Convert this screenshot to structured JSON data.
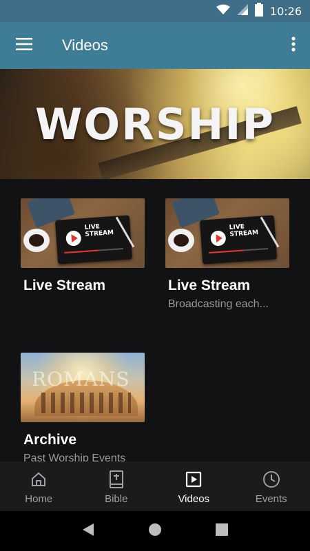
{
  "status_bar": {
    "time": "10:26"
  },
  "app_bar": {
    "title": "Videos"
  },
  "banner": {
    "title": "WORSHIP"
  },
  "cards": [
    {
      "title": "Live Stream",
      "subtitle": "",
      "thumb_text": "LIVE\nSTREAM"
    },
    {
      "title": "Live Stream",
      "subtitle": "Broadcasting each...",
      "thumb_text": "LIVE\nSTREAM"
    },
    {
      "title": "Archive",
      "subtitle": "Past Worship Events",
      "thumb_text": "ROMANS"
    }
  ],
  "bottom_nav": [
    {
      "label": "Home",
      "icon": "home-icon",
      "active": false
    },
    {
      "label": "Bible",
      "icon": "bible-icon",
      "active": false
    },
    {
      "label": "Videos",
      "icon": "video-icon",
      "active": true
    },
    {
      "label": "Events",
      "icon": "clock-icon",
      "active": false
    }
  ],
  "colors": {
    "app_bar": "#3f7d97",
    "status_bar": "#3f6f88",
    "background": "#121214",
    "nav_bg": "#1b1b1e"
  }
}
